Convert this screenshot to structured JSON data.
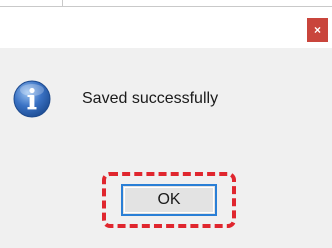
{
  "dialog": {
    "close_label": "×",
    "message": "Saved successfully",
    "icon": "info-icon",
    "ok_label": "OK"
  },
  "colors": {
    "close_button_bg": "#c9453c",
    "highlight_border": "#e0262e",
    "ok_button_border": "#2a7fd6",
    "dialog_body_bg": "#f0f0f0",
    "info_icon_blue": "#3a72c4"
  }
}
